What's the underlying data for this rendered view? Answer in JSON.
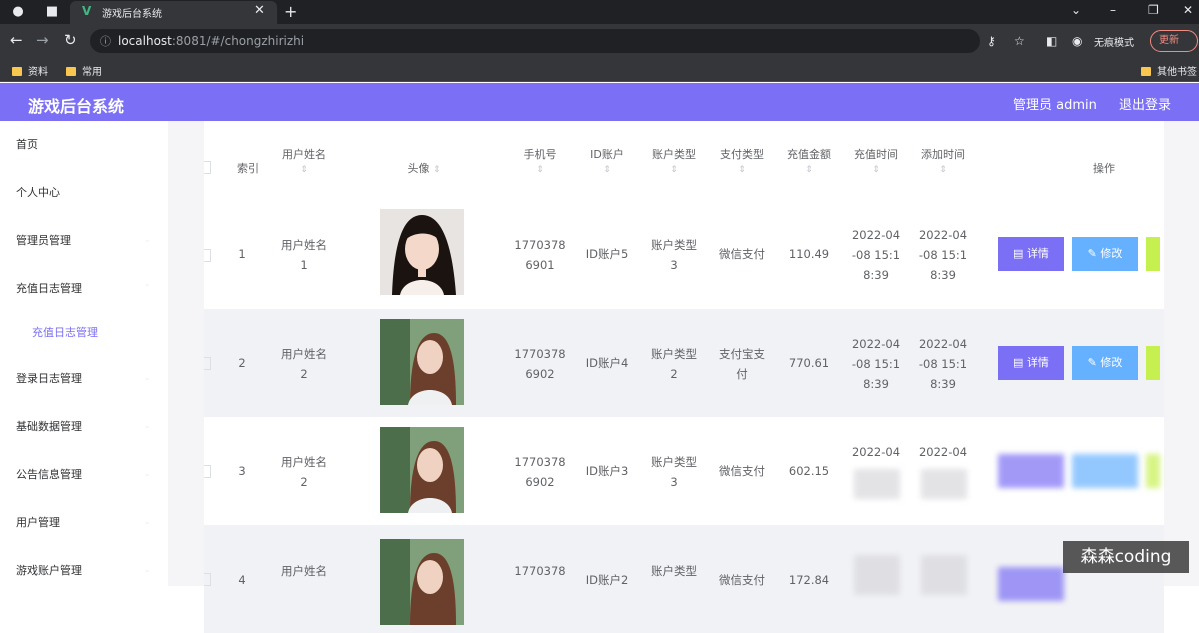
{
  "browser": {
    "tab_title": "游戏后台系统",
    "url_host": "localhost",
    "url_path": ":8081/#/chongzhirizhi",
    "incognito_label": "无痕模式",
    "update_label": "更新",
    "bookmarks": [
      "资料",
      "常用"
    ],
    "other_bookmarks": "其他书签"
  },
  "app": {
    "title": "游戏后台系统",
    "user_label": "管理员 admin",
    "logout_label": "退出登录",
    "accent": "#7b6ff5"
  },
  "sidebar": {
    "items": [
      {
        "label": "首页"
      },
      {
        "label": "个人中心"
      },
      {
        "label": "管理员管理"
      },
      {
        "label": "充值日志管理"
      },
      {
        "label": "充值日志管理",
        "sub": true
      },
      {
        "label": "登录日志管理"
      },
      {
        "label": "基础数据管理"
      },
      {
        "label": "公告信息管理"
      },
      {
        "label": "用户管理"
      },
      {
        "label": "游戏账户管理"
      }
    ]
  },
  "table": {
    "headers": {
      "index": "索引",
      "username": "用户姓名",
      "avatar": "头像",
      "phone": "手机号",
      "account_id": "ID账户",
      "account_type": "账户类型",
      "pay_type": "支付类型",
      "amount": "充值金额",
      "recharge_time": "充值时间",
      "add_time": "添加时间",
      "actions": "操作"
    },
    "detail_label": "详情",
    "edit_label": "修改",
    "rows": [
      {
        "index": "1",
        "username_a": "用户姓名",
        "username_b": "1",
        "phone_a": "1770378",
        "phone_b": "6901",
        "account_id": "ID账户5",
        "type_a": "账户类型",
        "type_b": "3",
        "pay_a": "微信支付",
        "pay_b": "",
        "amount": "110.49",
        "rt_a": "2022-04",
        "rt_b": "-08 15:1",
        "rt_c": "8:39",
        "at_a": "2022-04",
        "at_b": "-08 15:1",
        "at_c": "8:39"
      },
      {
        "index": "2",
        "username_a": "用户姓名",
        "username_b": "2",
        "phone_a": "1770378",
        "phone_b": "6902",
        "account_id": "ID账户4",
        "type_a": "账户类型",
        "type_b": "2",
        "pay_a": "支付宝支",
        "pay_b": "付",
        "amount": "770.61",
        "rt_a": "2022-04",
        "rt_b": "-08 15:1",
        "rt_c": "8:39",
        "at_a": "2022-04",
        "at_b": "-08 15:1",
        "at_c": "8:39"
      },
      {
        "index": "3",
        "username_a": "用户姓名",
        "username_b": "2",
        "phone_a": "1770378",
        "phone_b": "6902",
        "account_id": "ID账户3",
        "type_a": "账户类型",
        "type_b": "3",
        "pay_a": "微信支付",
        "pay_b": "",
        "amount": "602.15",
        "rt_a": "2022-04",
        "rt_b": "",
        "rt_c": "",
        "at_a": "2022-04",
        "at_b": "",
        "at_c": ""
      },
      {
        "index": "4",
        "username_a": "用户姓名",
        "username_b": "",
        "phone_a": "1770378",
        "phone_b": "",
        "account_id": "ID账户2",
        "type_a": "账户类型",
        "type_b": "",
        "pay_a": "微信支付",
        "pay_b": "",
        "amount": "172.84",
        "rt_a": "",
        "rt_b": "",
        "rt_c": "",
        "at_a": "",
        "at_b": "",
        "at_c": ""
      }
    ]
  },
  "watermark": "森森coding"
}
